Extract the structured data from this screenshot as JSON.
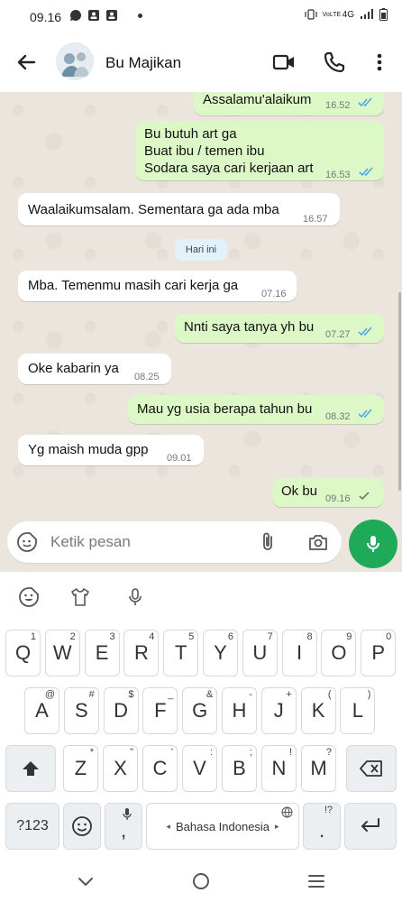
{
  "status_bar": {
    "time": "09.16",
    "network": "4G",
    "volte": "VoLTE"
  },
  "header": {
    "contact_name": "Bu Majikan",
    "icons": [
      "back-arrow-icon",
      "video-call-icon",
      "phone-icon",
      "more-vert-icon"
    ]
  },
  "messages": [
    {
      "dir": "out",
      "text": "Assalamu'alaikum",
      "time": "16.52",
      "ticks": "read"
    },
    {
      "dir": "out",
      "lines": [
        "Bu butuh art ga",
        "Buat ibu / temen ibu",
        "Sodara saya cari kerjaan art"
      ],
      "time": "16.53",
      "ticks": "read"
    },
    {
      "dir": "in",
      "text": "Waalaikumsalam. Sementara ga ada mba",
      "time": "16.57"
    },
    {
      "dir": "in",
      "text": "Mba. Temenmu masih cari kerja ga",
      "time": "07.16"
    },
    {
      "dir": "out",
      "text": "Nnti saya tanya yh bu",
      "time": "07.27",
      "ticks": "read"
    },
    {
      "dir": "in",
      "text": "Oke kabarin ya",
      "time": "08.25"
    },
    {
      "dir": "out",
      "text": "Mau yg usia berapa tahun bu",
      "time": "08.32",
      "ticks": "read"
    },
    {
      "dir": "in",
      "text": "Yg maish muda gpp",
      "time": "09.01"
    },
    {
      "dir": "out",
      "text": "Ok bu",
      "time": "09.16",
      "ticks": "sent"
    }
  ],
  "day_label": "Hari ini",
  "composer": {
    "placeholder": "Ketik pesan"
  },
  "keyboard": {
    "row1": [
      {
        "k": "Q",
        "s": "1"
      },
      {
        "k": "W",
        "s": "2"
      },
      {
        "k": "E",
        "s": "3"
      },
      {
        "k": "R",
        "s": "4"
      },
      {
        "k": "T",
        "s": "5"
      },
      {
        "k": "Y",
        "s": "6"
      },
      {
        "k": "U",
        "s": "7"
      },
      {
        "k": "I",
        "s": "8"
      },
      {
        "k": "O",
        "s": "9"
      },
      {
        "k": "P",
        "s": "0"
      }
    ],
    "row2": [
      {
        "k": "A",
        "s": "@"
      },
      {
        "k": "S",
        "s": "#"
      },
      {
        "k": "D",
        "s": "$"
      },
      {
        "k": "F",
        "s": "_"
      },
      {
        "k": "G",
        "s": "&"
      },
      {
        "k": "H",
        "s": "-"
      },
      {
        "k": "J",
        "s": "+"
      },
      {
        "k": "K",
        "s": "("
      },
      {
        "k": "L",
        "s": ")"
      }
    ],
    "row3": [
      {
        "k": "Z",
        "s": "*"
      },
      {
        "k": "X",
        "s": "\""
      },
      {
        "k": "C",
        "s": "'"
      },
      {
        "k": "V",
        "s": ":"
      },
      {
        "k": "B",
        "s": ";"
      },
      {
        "k": "N",
        "s": "!"
      },
      {
        "k": "M",
        "s": "?"
      }
    ],
    "symbols_key": "?123",
    "comma_key": ",",
    "space_label": "Bahasa Indonesia",
    "period_key": ".",
    "period_sup": "!?"
  }
}
